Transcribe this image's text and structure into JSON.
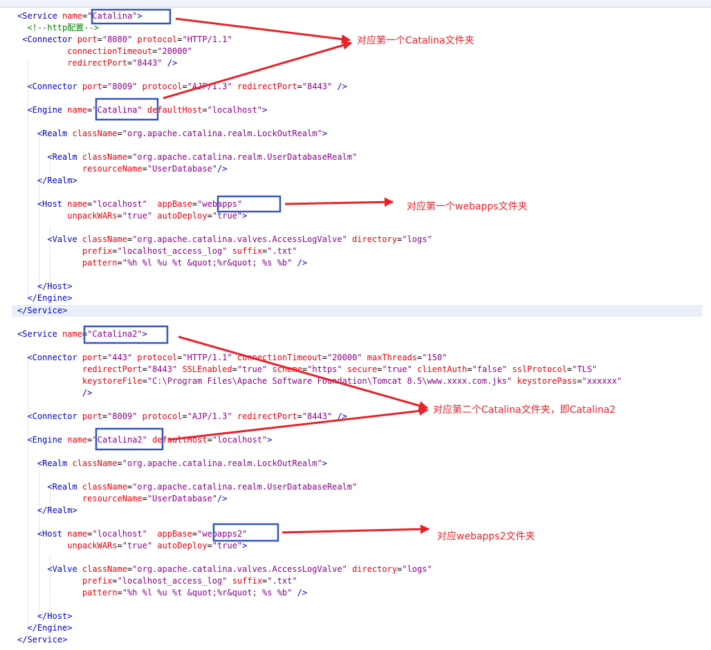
{
  "lines": [
    {
      "tokens": [
        {
          "c": "t",
          "s": "<Service "
        },
        {
          "c": "a",
          "s": "name"
        },
        {
          "c": "p",
          "s": "="
        },
        {
          "c": "v",
          "s": "\"Catalina\""
        },
        {
          "c": "t",
          "s": ">"
        }
      ]
    },
    {
      "tokens": [
        {
          "c": "c",
          "s": "  <!--http配置-->"
        }
      ]
    },
    {
      "tokens": [
        {
          "c": "t",
          "s": " <Connector "
        },
        {
          "c": "a",
          "s": "port"
        },
        {
          "c": "p",
          "s": "="
        },
        {
          "c": "v",
          "s": "\"8080\""
        },
        {
          "c": "a",
          "s": " protocol"
        },
        {
          "c": "p",
          "s": "="
        },
        {
          "c": "v",
          "s": "\"HTTP/1.1\""
        }
      ]
    },
    {
      "tokens": [
        {
          "c": "a",
          "s": "          connectionTimeout"
        },
        {
          "c": "p",
          "s": "="
        },
        {
          "c": "v",
          "s": "\"20000\""
        }
      ]
    },
    {
      "tokens": [
        {
          "c": "a",
          "s": "          redirectPort"
        },
        {
          "c": "p",
          "s": "="
        },
        {
          "c": "v",
          "s": "\"8443\""
        },
        {
          "c": "t",
          "s": " />"
        }
      ]
    },
    {
      "tokens": []
    },
    {
      "tokens": [
        {
          "c": "t",
          "s": "  <Connector "
        },
        {
          "c": "a",
          "s": "port"
        },
        {
          "c": "p",
          "s": "="
        },
        {
          "c": "v",
          "s": "\"8009\""
        },
        {
          "c": "a",
          "s": " protocol"
        },
        {
          "c": "p",
          "s": "="
        },
        {
          "c": "v",
          "s": "\"AJP/1.3\""
        },
        {
          "c": "a",
          "s": " redirectPort"
        },
        {
          "c": "p",
          "s": "="
        },
        {
          "c": "v",
          "s": "\"8443\""
        },
        {
          "c": "t",
          "s": " />"
        }
      ]
    },
    {
      "tokens": []
    },
    {
      "tokens": [
        {
          "c": "t",
          "s": "  <Engine "
        },
        {
          "c": "a",
          "s": "name"
        },
        {
          "c": "p",
          "s": "="
        },
        {
          "c": "v",
          "s": "\"Catalina\""
        },
        {
          "c": "a",
          "s": " defaultHost"
        },
        {
          "c": "p",
          "s": "="
        },
        {
          "c": "v",
          "s": "\"localhost\""
        },
        {
          "c": "t",
          "s": ">"
        }
      ]
    },
    {
      "tokens": []
    },
    {
      "tokens": [
        {
          "c": "t",
          "s": "    <Realm "
        },
        {
          "c": "a",
          "s": "className"
        },
        {
          "c": "p",
          "s": "="
        },
        {
          "c": "v",
          "s": "\"org.apache.catalina.realm.LockOutRealm\""
        },
        {
          "c": "t",
          "s": ">"
        }
      ]
    },
    {
      "tokens": []
    },
    {
      "tokens": [
        {
          "c": "t",
          "s": "      <Realm "
        },
        {
          "c": "a",
          "s": "className"
        },
        {
          "c": "p",
          "s": "="
        },
        {
          "c": "v",
          "s": "\"org.apache.catalina.realm.UserDatabaseRealm\""
        }
      ]
    },
    {
      "tokens": [
        {
          "c": "a",
          "s": "             resourceName"
        },
        {
          "c": "p",
          "s": "="
        },
        {
          "c": "v",
          "s": "\"UserDatabase\""
        },
        {
          "c": "t",
          "s": "/>"
        }
      ]
    },
    {
      "tokens": [
        {
          "c": "t",
          "s": "    </Realm>"
        }
      ]
    },
    {
      "tokens": []
    },
    {
      "tokens": [
        {
          "c": "t",
          "s": "    <Host "
        },
        {
          "c": "a",
          "s": "name"
        },
        {
          "c": "p",
          "s": "="
        },
        {
          "c": "v",
          "s": "\"localhost\""
        },
        {
          "c": "a",
          "s": "  appBase"
        },
        {
          "c": "p",
          "s": "="
        },
        {
          "c": "v",
          "s": "\"webapps\""
        }
      ]
    },
    {
      "tokens": [
        {
          "c": "a",
          "s": "          unpackWARs"
        },
        {
          "c": "p",
          "s": "="
        },
        {
          "c": "v",
          "s": "\"true\""
        },
        {
          "c": "a",
          "s": " autoDeploy"
        },
        {
          "c": "p",
          "s": "="
        },
        {
          "c": "v",
          "s": "\"true\""
        },
        {
          "c": "t",
          "s": ">"
        }
      ]
    },
    {
      "tokens": []
    },
    {
      "tokens": [
        {
          "c": "t",
          "s": "      <Valve "
        },
        {
          "c": "a",
          "s": "className"
        },
        {
          "c": "p",
          "s": "="
        },
        {
          "c": "v",
          "s": "\"org.apache.catalina.valves.AccessLogValve\""
        },
        {
          "c": "a",
          "s": " directory"
        },
        {
          "c": "p",
          "s": "="
        },
        {
          "c": "v",
          "s": "\"logs\""
        }
      ]
    },
    {
      "tokens": [
        {
          "c": "a",
          "s": "             prefix"
        },
        {
          "c": "p",
          "s": "="
        },
        {
          "c": "v",
          "s": "\"localhost_access_log\""
        },
        {
          "c": "a",
          "s": " suffix"
        },
        {
          "c": "p",
          "s": "="
        },
        {
          "c": "v",
          "s": "\".txt\""
        }
      ]
    },
    {
      "tokens": [
        {
          "c": "a",
          "s": "             pattern"
        },
        {
          "c": "p",
          "s": "="
        },
        {
          "c": "v",
          "s": "\"%h %l %u %t &quot;%r&quot; %s %b\""
        },
        {
          "c": "t",
          "s": " />"
        }
      ]
    },
    {
      "tokens": []
    },
    {
      "tokens": [
        {
          "c": "t",
          "s": "    </Host>"
        }
      ]
    },
    {
      "tokens": [
        {
          "c": "t",
          "s": "  </Engine>"
        }
      ]
    },
    {
      "tokens": [
        {
          "c": "t",
          "s": "</Service>"
        }
      ],
      "hl": true
    },
    {
      "tokens": []
    },
    {
      "tokens": [
        {
          "c": "t",
          "s": "<Service "
        },
        {
          "c": "a",
          "s": "name"
        },
        {
          "c": "p",
          "s": "="
        },
        {
          "c": "v",
          "s": "\"Catalina2\""
        },
        {
          "c": "t",
          "s": ">"
        }
      ]
    },
    {
      "tokens": []
    },
    {
      "tokens": [
        {
          "c": "t",
          "s": "  <Connector "
        },
        {
          "c": "a",
          "s": "port"
        },
        {
          "c": "p",
          "s": "="
        },
        {
          "c": "v",
          "s": "\"443\""
        },
        {
          "c": "a",
          "s": " protocol"
        },
        {
          "c": "p",
          "s": "="
        },
        {
          "c": "v",
          "s": "\"HTTP/1.1\""
        },
        {
          "c": "a",
          "s": " connectionTimeout"
        },
        {
          "c": "p",
          "s": "="
        },
        {
          "c": "v",
          "s": "\"20000\""
        },
        {
          "c": "a",
          "s": " maxThreads"
        },
        {
          "c": "p",
          "s": "="
        },
        {
          "c": "v",
          "s": "\"150\""
        }
      ]
    },
    {
      "tokens": [
        {
          "c": "a",
          "s": "             redirectPort"
        },
        {
          "c": "p",
          "s": "="
        },
        {
          "c": "v",
          "s": "\"8443\""
        },
        {
          "c": "a",
          "s": " SSLEnabled"
        },
        {
          "c": "p",
          "s": "="
        },
        {
          "c": "v",
          "s": "\"true\""
        },
        {
          "c": "a",
          "s": " scheme"
        },
        {
          "c": "p",
          "s": "="
        },
        {
          "c": "v",
          "s": "\"https\""
        },
        {
          "c": "a",
          "s": " secure"
        },
        {
          "c": "p",
          "s": "="
        },
        {
          "c": "v",
          "s": "\"true\""
        },
        {
          "c": "a",
          "s": " clientAuth"
        },
        {
          "c": "p",
          "s": "="
        },
        {
          "c": "v",
          "s": "\"false\""
        },
        {
          "c": "a",
          "s": " sslProtocol"
        },
        {
          "c": "p",
          "s": "="
        },
        {
          "c": "v",
          "s": "\"TLS\""
        }
      ]
    },
    {
      "tokens": [
        {
          "c": "a",
          "s": "             keystoreFile"
        },
        {
          "c": "p",
          "s": "="
        },
        {
          "c": "v",
          "s": "\"C:\\Program Files\\Apache Software Foundation\\Tomcat 8.5\\www.xxxx.com.jks\""
        },
        {
          "c": "a",
          "s": " keystorePass"
        },
        {
          "c": "p",
          "s": "="
        },
        {
          "c": "v",
          "s": "\"xxxxxx\""
        }
      ]
    },
    {
      "tokens": [
        {
          "c": "t",
          "s": "             />"
        }
      ]
    },
    {
      "tokens": []
    },
    {
      "tokens": [
        {
          "c": "t",
          "s": "  <Connector "
        },
        {
          "c": "a",
          "s": "port"
        },
        {
          "c": "p",
          "s": "="
        },
        {
          "c": "v",
          "s": "\"8009\""
        },
        {
          "c": "a",
          "s": " protocol"
        },
        {
          "c": "p",
          "s": "="
        },
        {
          "c": "v",
          "s": "\"AJP/1.3\""
        },
        {
          "c": "a",
          "s": " redirectPort"
        },
        {
          "c": "p",
          "s": "="
        },
        {
          "c": "v",
          "s": "\"8443\""
        },
        {
          "c": "t",
          "s": " />"
        }
      ]
    },
    {
      "tokens": []
    },
    {
      "tokens": [
        {
          "c": "t",
          "s": "  <Engine "
        },
        {
          "c": "a",
          "s": "name"
        },
        {
          "c": "p",
          "s": "="
        },
        {
          "c": "v",
          "s": "\"Catalina2\""
        },
        {
          "c": "a",
          "s": " defaultHost"
        },
        {
          "c": "p",
          "s": "="
        },
        {
          "c": "v",
          "s": "\"localhost\""
        },
        {
          "c": "t",
          "s": ">"
        }
      ]
    },
    {
      "tokens": []
    },
    {
      "tokens": [
        {
          "c": "t",
          "s": "    <Realm "
        },
        {
          "c": "a",
          "s": "className"
        },
        {
          "c": "p",
          "s": "="
        },
        {
          "c": "v",
          "s": "\"org.apache.catalina.realm.LockOutRealm\""
        },
        {
          "c": "t",
          "s": ">"
        }
      ]
    },
    {
      "tokens": []
    },
    {
      "tokens": [
        {
          "c": "t",
          "s": "      <Realm "
        },
        {
          "c": "a",
          "s": "className"
        },
        {
          "c": "p",
          "s": "="
        },
        {
          "c": "v",
          "s": "\"org.apache.catalina.realm.UserDatabaseRealm\""
        }
      ]
    },
    {
      "tokens": [
        {
          "c": "a",
          "s": "             resourceName"
        },
        {
          "c": "p",
          "s": "="
        },
        {
          "c": "v",
          "s": "\"UserDatabase\""
        },
        {
          "c": "t",
          "s": "/>"
        }
      ]
    },
    {
      "tokens": [
        {
          "c": "t",
          "s": "    </Realm>"
        }
      ]
    },
    {
      "tokens": []
    },
    {
      "tokens": [
        {
          "c": "t",
          "s": "    <Host "
        },
        {
          "c": "a",
          "s": "name"
        },
        {
          "c": "p",
          "s": "="
        },
        {
          "c": "v",
          "s": "\"localhost\""
        },
        {
          "c": "a",
          "s": "  appBase"
        },
        {
          "c": "p",
          "s": "="
        },
        {
          "c": "v",
          "s": "\"webapps2\""
        }
      ]
    },
    {
      "tokens": [
        {
          "c": "a",
          "s": "          unpackWARs"
        },
        {
          "c": "p",
          "s": "="
        },
        {
          "c": "v",
          "s": "\"true\""
        },
        {
          "c": "a",
          "s": " autoDeploy"
        },
        {
          "c": "p",
          "s": "="
        },
        {
          "c": "v",
          "s": "\"true\""
        },
        {
          "c": "t",
          "s": ">"
        }
      ]
    },
    {
      "tokens": []
    },
    {
      "tokens": [
        {
          "c": "t",
          "s": "      <Valve "
        },
        {
          "c": "a",
          "s": "className"
        },
        {
          "c": "p",
          "s": "="
        },
        {
          "c": "v",
          "s": "\"org.apache.catalina.valves.AccessLogValve\""
        },
        {
          "c": "a",
          "s": " directory"
        },
        {
          "c": "p",
          "s": "="
        },
        {
          "c": "v",
          "s": "\"logs\""
        }
      ]
    },
    {
      "tokens": [
        {
          "c": "a",
          "s": "             prefix"
        },
        {
          "c": "p",
          "s": "="
        },
        {
          "c": "v",
          "s": "\"localhost_access_log\""
        },
        {
          "c": "a",
          "s": " suffix"
        },
        {
          "c": "p",
          "s": "="
        },
        {
          "c": "v",
          "s": "\".txt\""
        }
      ]
    },
    {
      "tokens": [
        {
          "c": "a",
          "s": "             pattern"
        },
        {
          "c": "p",
          "s": "="
        },
        {
          "c": "v",
          "s": "\"%h %l %u %t &quot;%r&quot; %s %b\""
        },
        {
          "c": "t",
          "s": " />"
        }
      ]
    },
    {
      "tokens": []
    },
    {
      "tokens": [
        {
          "c": "t",
          "s": "    </Host>"
        }
      ]
    },
    {
      "tokens": [
        {
          "c": "t",
          "s": "  </Engine>"
        }
      ]
    },
    {
      "tokens": [
        {
          "c": "t",
          "s": "</Service>"
        }
      ]
    }
  ],
  "annotations": {
    "callout_catalina": "对应第一个Catalina文件夹",
    "callout_webapps": "对应第一个webapps文件夹",
    "callout_catalina2": "对应第二个Catalina文件夹，即Catalina2",
    "callout_webapps2": "对应webapps2文件夹"
  },
  "colors": {
    "tag": "#0000c0",
    "attribute": "#e8000c",
    "value": "#8b008b",
    "comment": "#008000",
    "highlight_box": "#3355bb",
    "arrow": "#e8212a"
  }
}
